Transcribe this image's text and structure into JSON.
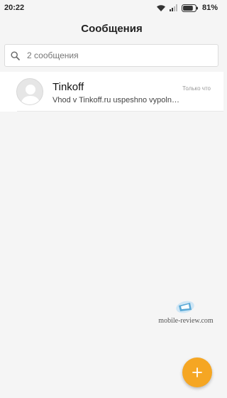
{
  "status_bar": {
    "time": "20:22",
    "battery_percent": "81%",
    "battery_level": 0.81,
    "icons": [
      "wifi-icon",
      "signal-icon",
      "battery-icon"
    ]
  },
  "header": {
    "title": "Сообщения"
  },
  "search": {
    "placeholder": "2 сообщения",
    "icon": "search-icon"
  },
  "conversations": [
    {
      "name": "Tinkoff",
      "time": "Только что",
      "snippet": "Vhod v Tinkoff.ru uspeshno vypoln…",
      "avatar": "default-contact-avatar"
    }
  ],
  "watermark": {
    "text": "mobile-review.com"
  },
  "fab": {
    "icon": "plus-icon",
    "color": "#f5a623"
  },
  "colors": {
    "background": "#f5f5f5",
    "accent": "#f5a623"
  }
}
